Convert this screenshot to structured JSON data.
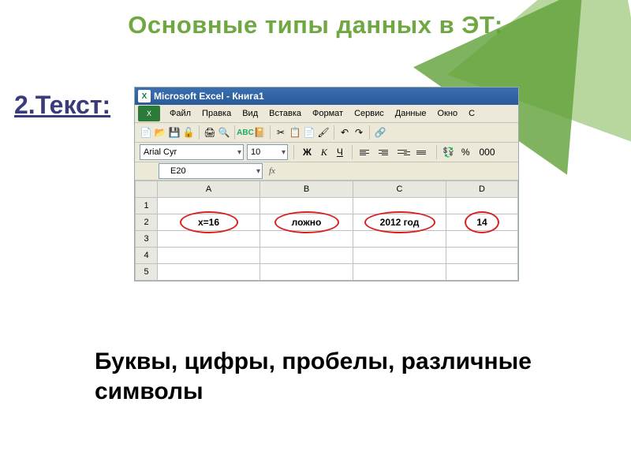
{
  "slide": {
    "title": "Основные типы данных в ЭТ:",
    "side_label": "2.Текст:",
    "caption": "Буквы, цифры, пробелы, различные символы"
  },
  "excel": {
    "titlebar": "Microsoft Excel - Книга1",
    "menu": {
      "file": "Файл",
      "edit": "Правка",
      "view": "Вид",
      "insert": "Вставка",
      "format": "Формат",
      "tools": "Сервис",
      "data": "Данные",
      "window": "Окно",
      "help_initial": "С"
    },
    "format_bar": {
      "font_name": "Arial Cyr",
      "font_size": "10",
      "bold": "Ж",
      "italic": "К",
      "underline": "Ч",
      "percent": "%",
      "thousands": "000"
    },
    "name_box": "E20",
    "fx_label": "fx",
    "columns": [
      "A",
      "B",
      "C",
      "D"
    ],
    "rows": [
      "1",
      "2",
      "3",
      "4",
      "5"
    ],
    "cells": {
      "A2": "x=16",
      "B2": "ложно",
      "C2": "2012 год",
      "D2": "14"
    }
  }
}
